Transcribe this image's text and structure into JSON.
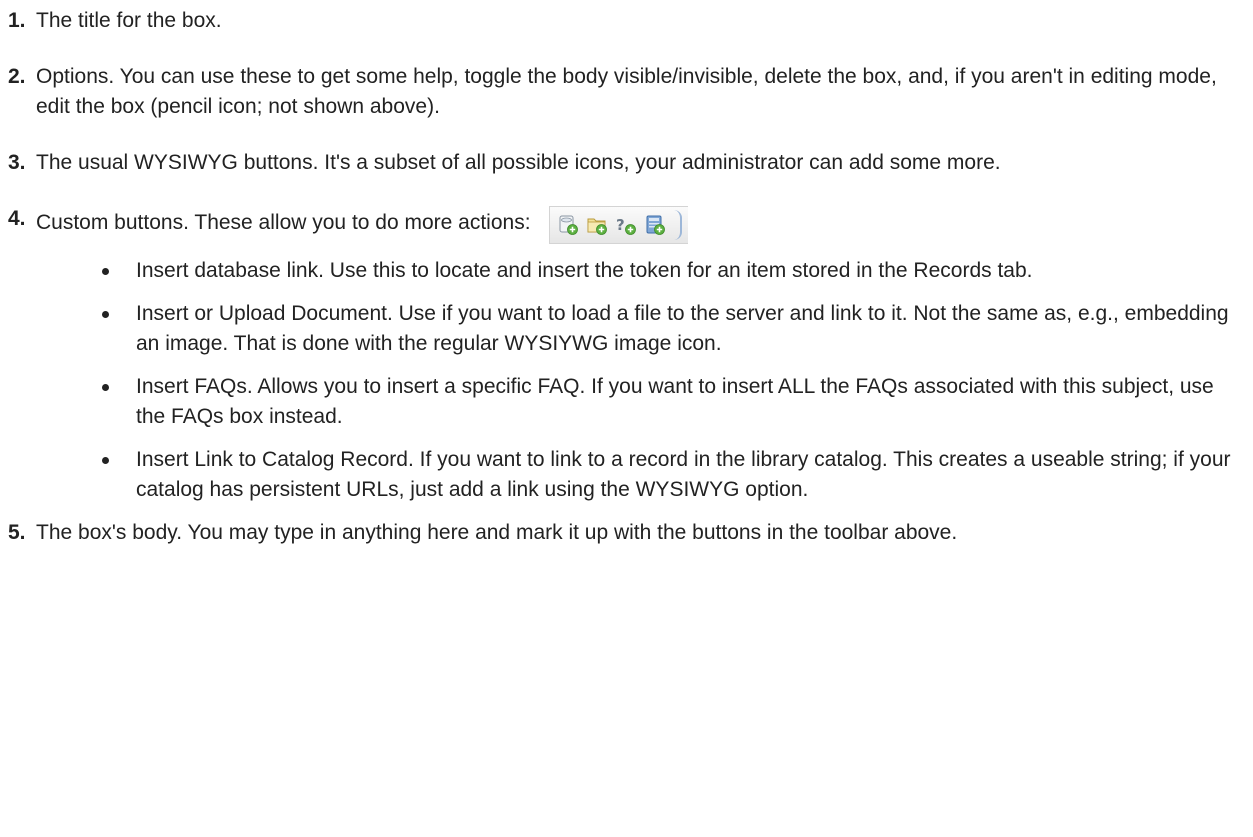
{
  "items": [
    {
      "number": "1.",
      "text": "The title for the box."
    },
    {
      "number": "2.",
      "text": "Options. You can use these to get some help, toggle the body visible/invisible, delete the box, and, if you aren't in editing mode, edit the box (pencil icon; not shown above)."
    },
    {
      "number": "3.",
      "text": "The usual WYSIWYG buttons. It's a subset of all possible icons, your administrator can add some more."
    },
    {
      "number": "4.",
      "text": "Custom buttons. These allow you to do more actions:"
    },
    {
      "number": "5.",
      "text": "The box's body. You may type in anything here and mark it up with the buttons in the toolbar above."
    }
  ],
  "custom_buttons": [
    {
      "icon": "insert-database-link-icon"
    },
    {
      "icon": "insert-upload-document-icon"
    },
    {
      "icon": "insert-faqs-icon"
    },
    {
      "icon": "insert-catalog-link-icon"
    }
  ],
  "bullets": [
    "Insert database link. Use this to locate and insert the token for an item stored in the Records tab.",
    "Insert or Upload Document. Use if you want to load a file to the server and link to it. Not the same as, e.g., embedding an image. That is done with the regular WYSIYWG image icon.",
    "Insert FAQs. Allows you to insert a specific FAQ. If you want to insert ALL the FAQs associated with this subject, use the FAQs box instead.",
    "Insert Link to Catalog Record. If you want to link to a record in the library catalog. This creates a useable string; if your catalog has persistent URLs, just add a link using the WYSIWYG option."
  ],
  "colors": {
    "text": "#222222",
    "icon_green": "#5cb040",
    "icon_blue": "#4a7fc1",
    "toolbar_bg": "#ececec"
  }
}
